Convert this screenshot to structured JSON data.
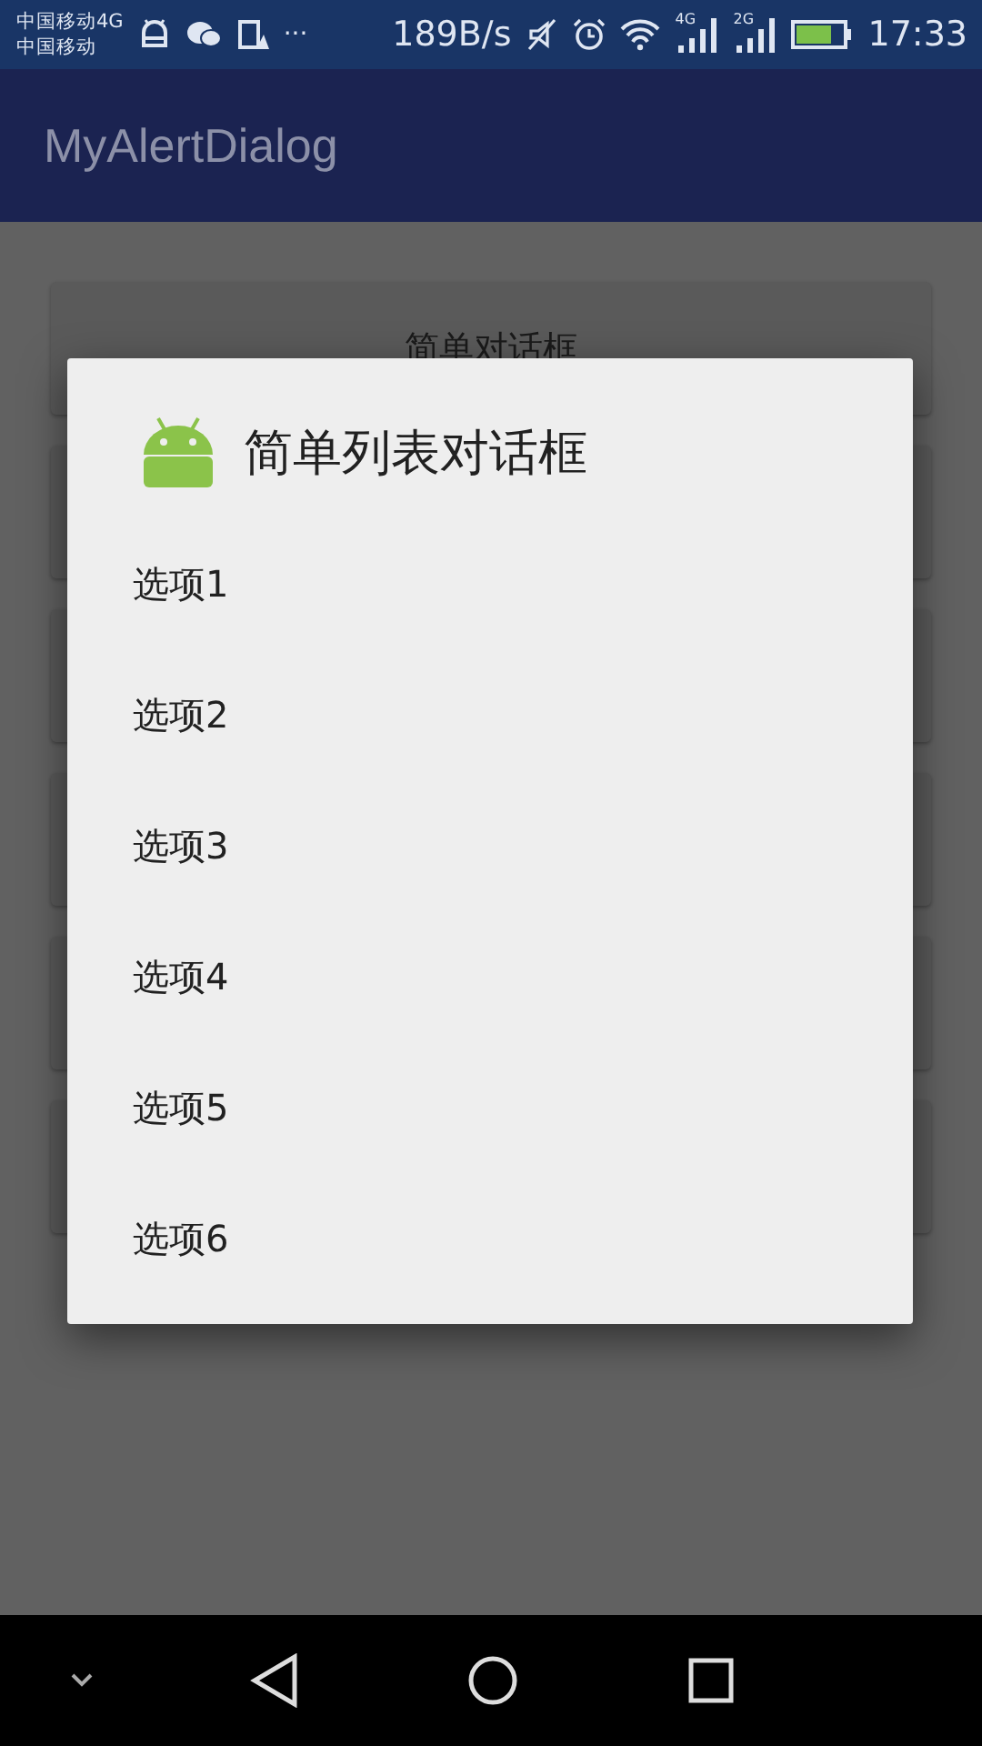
{
  "status_bar": {
    "carrier_1": "中国移动4G",
    "carrier_2": "中国移动",
    "more": "···",
    "speed": "189B/s",
    "sim_1": "4G",
    "sim_2": "2G",
    "time": "17:33"
  },
  "app_bar": {
    "title": "MyAlertDialog"
  },
  "buttons": [
    {
      "label": "简单对话框"
    }
  ],
  "dialog": {
    "title": "简单列表对话框",
    "items": [
      {
        "label": "选项1"
      },
      {
        "label": "选项2"
      },
      {
        "label": "选项3"
      },
      {
        "label": "选项4"
      },
      {
        "label": "选项5"
      },
      {
        "label": "选项6"
      }
    ]
  }
}
